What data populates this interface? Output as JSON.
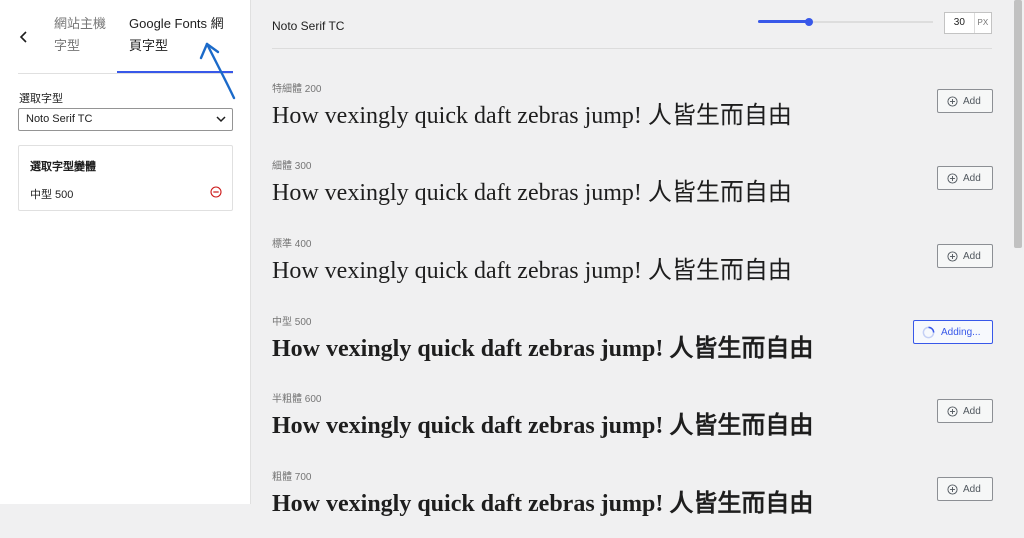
{
  "sidebar": {
    "tabs": [
      {
        "label": "網站主機字型"
      },
      {
        "label": "Google Fonts 網頁字型"
      }
    ],
    "select_label": "選取字型",
    "selected_font": "Noto Serif TC",
    "variants_box": {
      "title": "選取字型變體",
      "selected_variant": "中型 500"
    }
  },
  "preview": {
    "font_name": "Noto Serif TC",
    "size_value": "30",
    "size_unit": "PX",
    "size_slider_fraction": 0.29,
    "sample_text": "How vexingly quick daft zebras jump! 人皆生而自由",
    "variants": [
      {
        "label": "特細體 200",
        "button": "Add",
        "state": "normal",
        "weight": 200
      },
      {
        "label": "細體 300",
        "button": "Add",
        "state": "normal",
        "weight": 300
      },
      {
        "label": "標準 400",
        "button": "Add",
        "state": "normal",
        "weight": 400
      },
      {
        "label": "中型 500",
        "button": "Adding...",
        "state": "adding",
        "weight": 500
      },
      {
        "label": "半粗體 600",
        "button": "Add",
        "state": "normal",
        "weight": 600
      },
      {
        "label": "粗體 700",
        "button": "Add",
        "state": "normal",
        "weight": 700
      }
    ]
  },
  "colors": {
    "accent": "#3858e9"
  }
}
